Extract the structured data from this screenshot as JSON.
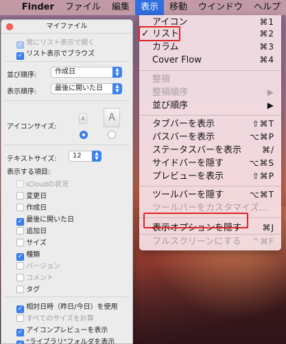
{
  "menubar": {
    "apple": "",
    "app": "Finder",
    "items": [
      "ファイル",
      "編集",
      "表示",
      "移動",
      "ウインドウ",
      "ヘルプ"
    ]
  },
  "view_menu": {
    "items": [
      {
        "label": "アイコン",
        "shortcut": "⌘1",
        "checked": false,
        "enabled": true
      },
      {
        "label": "リスト",
        "shortcut": "⌘2",
        "checked": true,
        "enabled": true
      },
      {
        "label": "カラム",
        "shortcut": "⌘3",
        "checked": false,
        "enabled": true
      },
      {
        "label": "Cover Flow",
        "shortcut": "⌘4",
        "checked": false,
        "enabled": true
      },
      {
        "label": "整頓",
        "shortcut": "",
        "enabled": false
      },
      {
        "label": "整頓順序",
        "shortcut": "▶",
        "enabled": false
      },
      {
        "label": "並び順序",
        "shortcut": "▶",
        "enabled": true
      },
      {
        "label": "タブバーを表示",
        "shortcut": "⇧⌘T",
        "enabled": true
      },
      {
        "label": "パスバーを表示",
        "shortcut": "⌥⌘P",
        "enabled": true
      },
      {
        "label": "ステータスバーを表示",
        "shortcut": "⌘/",
        "enabled": true
      },
      {
        "label": "サイドバーを隠す",
        "shortcut": "⌥⌘S",
        "enabled": true
      },
      {
        "label": "プレビューを表示",
        "shortcut": "⇧⌘P",
        "enabled": true
      },
      {
        "label": "ツールバーを隠す",
        "shortcut": "⌥⌘T",
        "enabled": true
      },
      {
        "label": "ツールバーをカスタマイズ...",
        "shortcut": "",
        "enabled": false
      },
      {
        "label": "表示オプションを隠す",
        "shortcut": "⌘J",
        "enabled": true
      },
      {
        "label": "フルスクリーンにする",
        "shortcut": "^⌘F",
        "enabled": false
      }
    ]
  },
  "options_panel": {
    "title": "マイファイル",
    "always_list": "常にリスト表示で開く",
    "browse_list": "リスト表示でブラウズ",
    "sort_label": "並び順序:",
    "sort_value": "作成日",
    "arrange_label": "表示順序:",
    "arrange_value": "最後に開いた日",
    "icon_size_label": "アイコンサイズ:",
    "text_size_label": "テキストサイズ:",
    "text_size_value": "12",
    "show_columns_label": "表示する項目:",
    "columns": [
      {
        "label": "iCloudの状況",
        "checked": false,
        "enabled": false
      },
      {
        "label": "変更日",
        "checked": false,
        "enabled": true
      },
      {
        "label": "作成日",
        "checked": false,
        "enabled": true
      },
      {
        "label": "最後に開いた日",
        "checked": true,
        "enabled": true
      },
      {
        "label": "追加日",
        "checked": false,
        "enabled": true
      },
      {
        "label": "サイズ",
        "checked": false,
        "enabled": true
      },
      {
        "label": "種類",
        "checked": true,
        "enabled": true
      },
      {
        "label": "バージョン",
        "checked": false,
        "enabled": true
      },
      {
        "label": "コメント",
        "checked": false,
        "enabled": true
      },
      {
        "label": "タグ",
        "checked": false,
        "enabled": true
      }
    ],
    "relative_dates": "相対日時（昨日/今日）を使用",
    "calc_sizes": "すべてのサイズを計算",
    "icon_preview": "アイコンプレビューを表示",
    "library_folder": "\"ライブラリ\"フォルダを表示"
  },
  "colors": {
    "accent": "#3b82f0",
    "highlight_box": "#dd2222"
  }
}
